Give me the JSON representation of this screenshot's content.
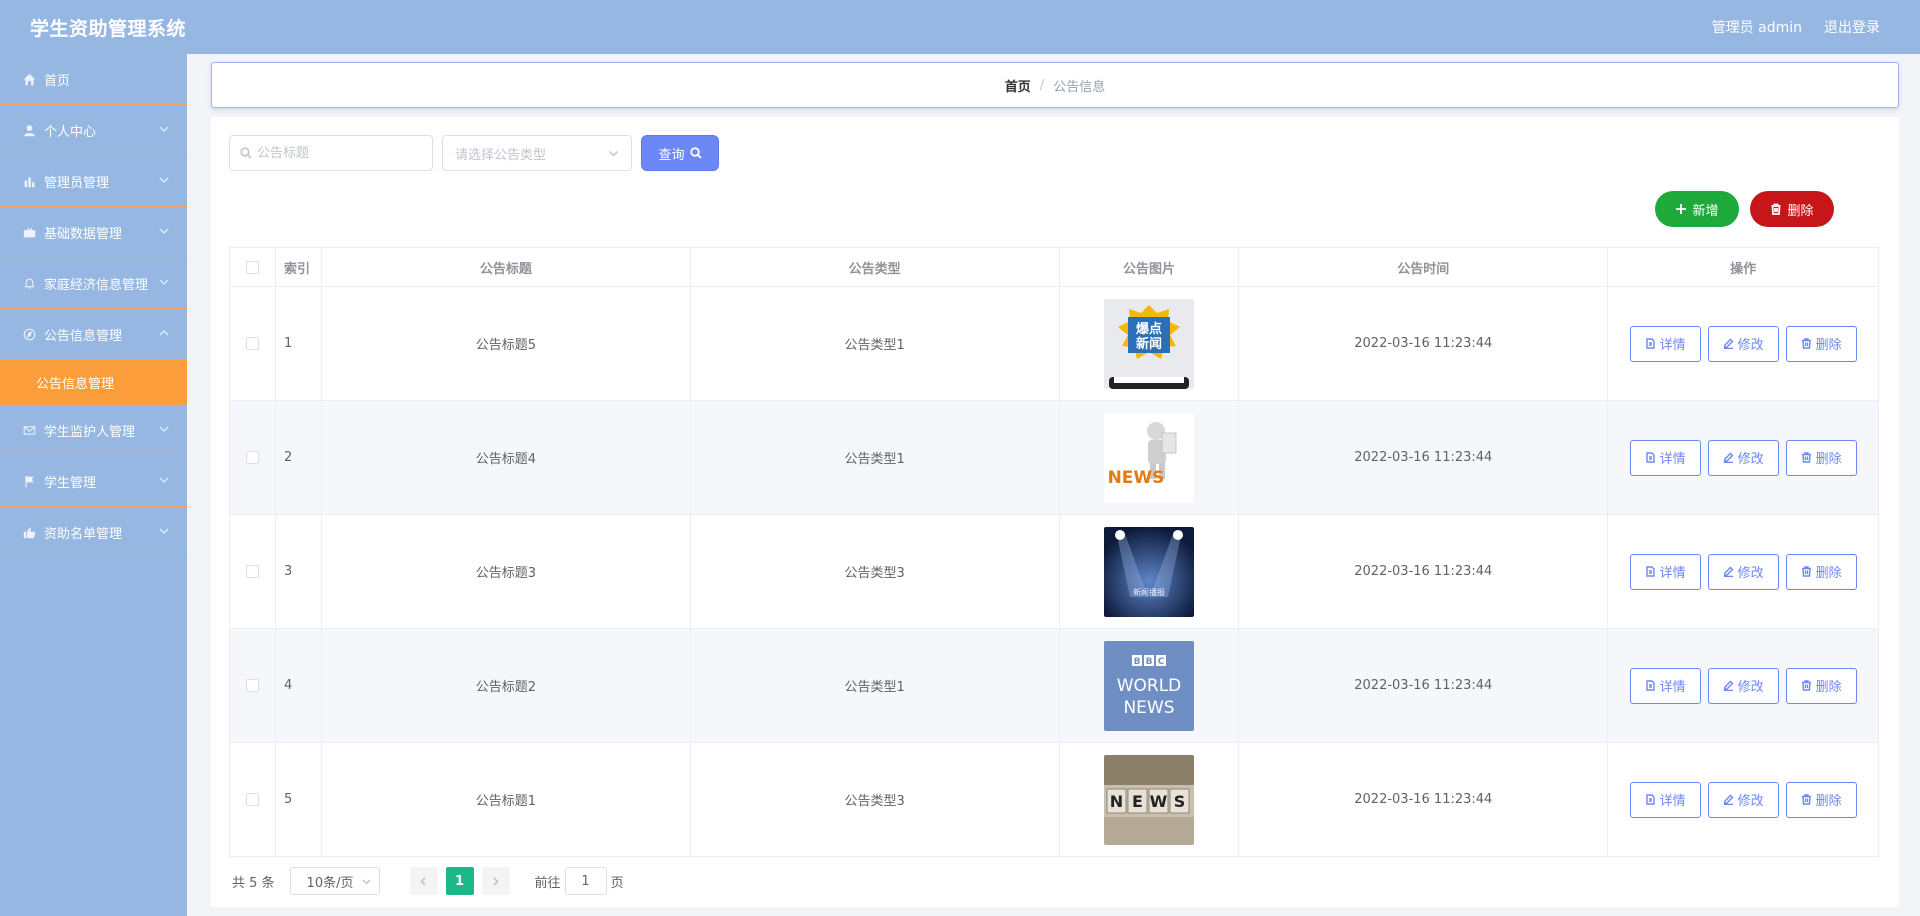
{
  "header": {
    "app_title": "学生资助管理系统",
    "user_label": "管理员 admin",
    "logout_label": "退出登录"
  },
  "sidebar": {
    "items": [
      {
        "label": "首页",
        "icon": "home-icon"
      },
      {
        "label": "个人中心",
        "icon": "user-icon"
      },
      {
        "label": "管理员管理",
        "icon": "bar-chart-icon"
      },
      {
        "label": "基础数据管理",
        "icon": "briefcase-icon"
      },
      {
        "label": "家庭经济信息管理",
        "icon": "bell-icon"
      },
      {
        "label": "公告信息管理",
        "icon": "compass-icon"
      },
      {
        "label": "学生监护人管理",
        "icon": "mail-icon"
      },
      {
        "label": "学生管理",
        "icon": "flag-icon"
      },
      {
        "label": "资助名单管理",
        "icon": "thumb-icon"
      }
    ],
    "active_submenu": "公告信息管理"
  },
  "breadcrumb": {
    "home": "首页",
    "separator": "/",
    "current": "公告信息"
  },
  "search": {
    "title_placeholder": "公告标题",
    "type_placeholder": "请选择公告类型",
    "query_label": "查询"
  },
  "actions": {
    "add_label": "新增",
    "delete_label": "删除"
  },
  "table": {
    "columns": [
      "索引",
      "公告标题",
      "公告类型",
      "公告图片",
      "公告时间",
      "操作"
    ],
    "op_labels": {
      "detail": "详情",
      "edit": "修改",
      "delete": "删除"
    },
    "rows": [
      {
        "index": "1",
        "title": "公告标题5",
        "type": "公告类型1",
        "image": "爆点新闻",
        "time": "2022-03-16 11:23:44"
      },
      {
        "index": "2",
        "title": "公告标题4",
        "type": "公告类型1",
        "image": "NEWS",
        "time": "2022-03-16 11:23:44"
      },
      {
        "index": "3",
        "title": "公告标题3",
        "type": "公告类型3",
        "image": "新闻播报",
        "time": "2022-03-16 11:23:44"
      },
      {
        "index": "4",
        "title": "公告标题2",
        "type": "公告类型1",
        "image": "BBC WORLD NEWS",
        "time": "2022-03-16 11:23:44"
      },
      {
        "index": "5",
        "title": "公告标题1",
        "type": "公告类型3",
        "image": "NEWS",
        "time": "2022-03-16 11:23:44"
      }
    ]
  },
  "pagination": {
    "total_text": "共 5 条",
    "page_size": "10条/页",
    "current_page": "1",
    "goto_prefix": "前往",
    "goto_value": "1",
    "goto_suffix": "页"
  },
  "colors": {
    "header_bg": "#95b7e2",
    "active_menu": "#fc9d3b",
    "primary": "#6c87f6",
    "success": "#1ea93b",
    "danger": "#c7161a",
    "page_active": "#1bb988"
  }
}
